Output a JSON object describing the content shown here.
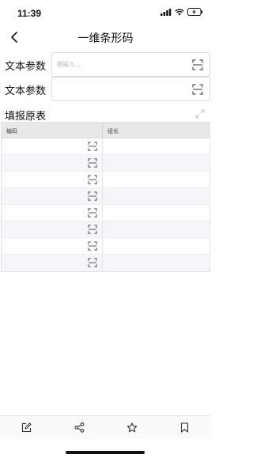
{
  "status_bar": {
    "time": "11:39"
  },
  "nav": {
    "title": "一维条形码"
  },
  "form": {
    "fields": [
      {
        "label": "文本参数",
        "placeholder": "请输入...",
        "value": ""
      },
      {
        "label": "文本参数",
        "placeholder": "",
        "value": ""
      }
    ]
  },
  "report_table": {
    "title": "填报原表",
    "columns": [
      "编码",
      "组长"
    ],
    "row_count_visible": 8
  },
  "toolbar": {
    "items": [
      "edit-icon",
      "share-icon",
      "star-icon",
      "bookmark-icon"
    ]
  },
  "colors": {
    "accent": "#1a1a1a",
    "header_bg": "#e8e8e8",
    "stripe_bg": "#f6f5f9"
  }
}
